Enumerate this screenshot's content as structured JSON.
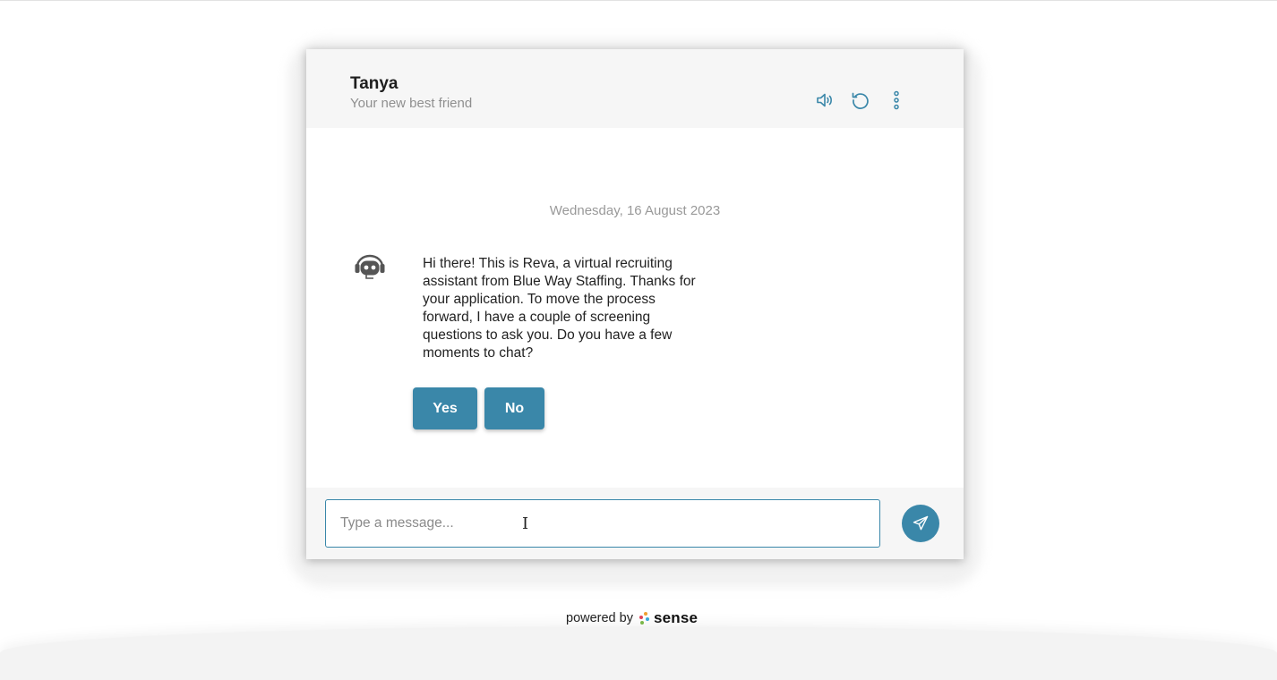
{
  "header": {
    "name": "Tanya",
    "tagline": "Your new best friend",
    "icons": [
      "speaker-icon",
      "refresh-icon",
      "more-vertical-icon"
    ]
  },
  "chat": {
    "date": "Wednesday, 16 August 2023",
    "avatar_icon": "bot-headset-icon",
    "message": "Hi there! This is Reva, a virtual recruiting assistant from Blue Way Staffing. Thanks for your application. To move the process forward, I have a couple of screening questions to ask you. Do you have a few moments to chat?",
    "quick_replies": [
      "Yes",
      "No"
    ]
  },
  "composer": {
    "placeholder": "Type a message...",
    "value": "",
    "send_icon": "paper-plane-icon"
  },
  "branding": {
    "powered_by": "powered by",
    "brand": "sense"
  },
  "colors": {
    "accent": "#3a87a9",
    "header_bg": "#f6f6f6",
    "text": "#222222",
    "muted": "#8f8f8f"
  }
}
